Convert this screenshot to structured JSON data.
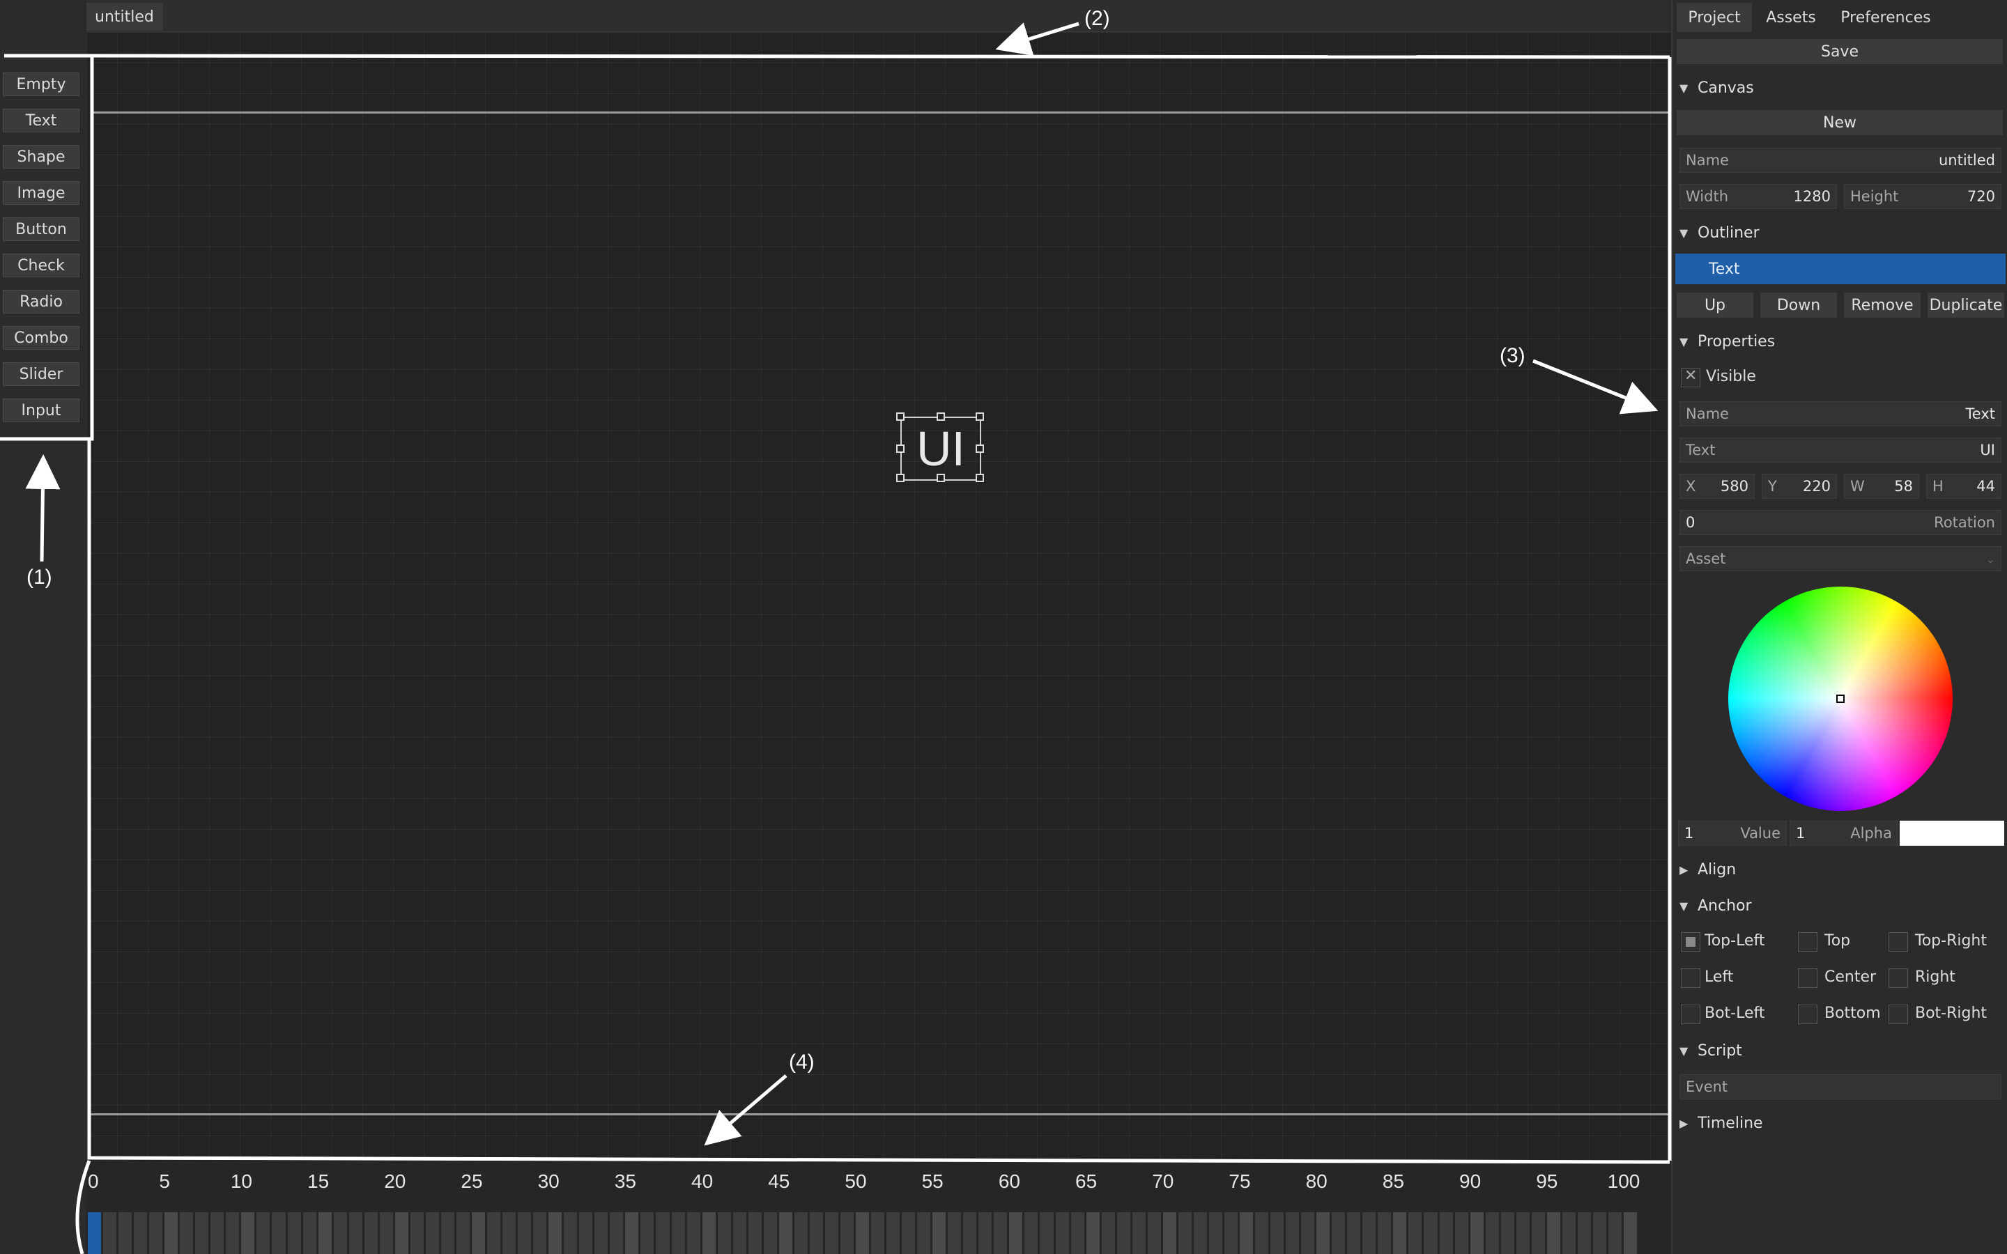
{
  "toolbox": {
    "items": [
      "Empty",
      "Text",
      "Shape",
      "Image",
      "Button",
      "Check",
      "Radio",
      "Combo",
      "Slider",
      "Input"
    ]
  },
  "document": {
    "tab_label": "untitled"
  },
  "canvas": {
    "selected_text": "UI"
  },
  "timeline": {
    "ticks": [
      "0",
      "5",
      "10",
      "15",
      "20",
      "25",
      "30",
      "35",
      "40",
      "45",
      "50",
      "55",
      "60",
      "65",
      "70",
      "75",
      "80",
      "85",
      "90",
      "95",
      "100"
    ],
    "current_frame": 0
  },
  "panel": {
    "tabs": [
      "Project",
      "Assets",
      "Preferences"
    ],
    "save_label": "Save",
    "canvas_section": "Canvas",
    "new_label": "New",
    "name_label": "Name",
    "name_value": "untitled",
    "width_label": "Width",
    "width_value": "1280",
    "height_label": "Height",
    "height_value": "720",
    "outliner_section": "Outliner",
    "outliner_items": [
      "Text"
    ],
    "up_label": "Up",
    "down_label": "Down",
    "remove_label": "Remove",
    "duplicate_label": "Duplicate",
    "properties_section": "Properties",
    "visible_label": "Visible",
    "prop_name_label": "Name",
    "prop_name_value": "Text",
    "prop_text_label": "Text",
    "prop_text_value": "UI",
    "x_label": "X",
    "x_value": "580",
    "y_label": "Y",
    "y_value": "220",
    "w_label": "W",
    "w_value": "58",
    "h_label": "H",
    "h_value": "44",
    "rotation_value": "0",
    "rotation_label": "Rotation",
    "asset_label": "Asset",
    "value_num": "1",
    "value_label": "Value",
    "alpha_num": "1",
    "alpha_label": "Alpha",
    "swatch_color": "#ffffff",
    "align_section": "Align",
    "anchor_section": "Anchor",
    "anchors": [
      "Top-Left",
      "Top",
      "Top-Right",
      "Left",
      "Center",
      "Right",
      "Bot-Left",
      "Bottom",
      "Bot-Right"
    ],
    "anchor_selected": "Top-Left",
    "script_section": "Script",
    "event_placeholder": "Event",
    "timeline_section": "Timeline",
    "accent_color": "#1f5fa8"
  },
  "annotations": [
    "(1)",
    "(2)",
    "(3)",
    "(4)"
  ]
}
